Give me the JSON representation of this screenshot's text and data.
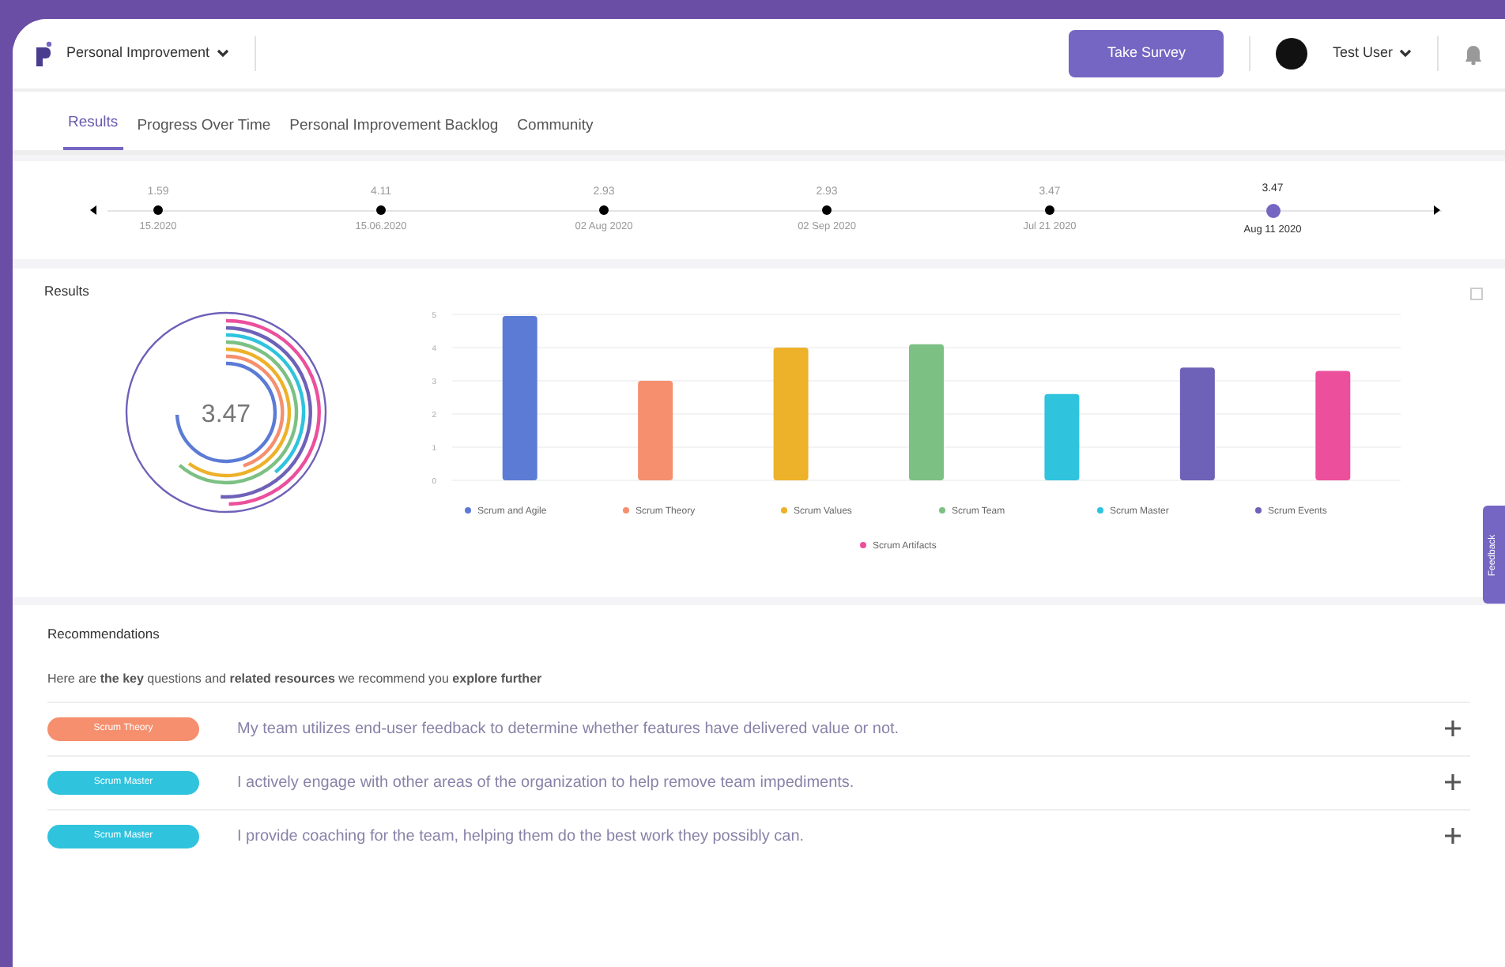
{
  "header": {
    "workspace": "Personal Improvement",
    "survey_button": "Take Survey",
    "user": "Test User"
  },
  "tabs": [
    {
      "label": "Results",
      "selected": true
    },
    {
      "label": "Progress Over Time",
      "selected": false
    },
    {
      "label": "Personal Improvement Backlog",
      "selected": false
    },
    {
      "label": "Community",
      "selected": false
    }
  ],
  "timeline": [
    {
      "score": "1.59",
      "date": "15.2020",
      "selected": false
    },
    {
      "score": "4.11",
      "date": "15.06.2020",
      "selected": false
    },
    {
      "score": "2.93",
      "date": "02 Aug 2020",
      "selected": false
    },
    {
      "score": "2.93",
      "date": "02 Sep 2020",
      "selected": false
    },
    {
      "score": "3.47",
      "date": "Jul 21 2020",
      "selected": false
    },
    {
      "score": "3.47",
      "date": "Aug 11 2020",
      "selected": true
    }
  ],
  "results": {
    "title": "Results",
    "overall_score": "3.47",
    "chart_data": {
      "type": "bar",
      "grid": true,
      "legend": "bottom",
      "series": [
        {
          "name": "Scrum and Agile",
          "color": "#5b7bd5",
          "values": [
            4.95
          ]
        },
        {
          "name": "Scrum Theory",
          "color": "#f58f6e",
          "values": [
            3.0
          ]
        },
        {
          "name": "Scrum Values",
          "color": "#edb12a",
          "values": [
            4.0
          ]
        },
        {
          "name": "Scrum Team",
          "color": "#7cc083",
          "values": [
            4.1
          ]
        },
        {
          "name": "Scrum Master",
          "color": "#2fc3de",
          "values": [
            2.6
          ]
        },
        {
          "name": "Scrum Events",
          "color": "#6e61b8",
          "values": [
            3.4
          ]
        },
        {
          "name": "Scrum Artifacts",
          "color": "#ec4f9c",
          "values": [
            3.3
          ]
        }
      ],
      "ylim": [
        0,
        5
      ],
      "yticks": [
        0,
        1,
        2,
        3,
        4,
        5
      ]
    }
  },
  "recommendations": {
    "title": "Recommendations",
    "intro": "Here are **the key** questions and **related resources** we recommend you **explore further**",
    "items": [
      {
        "tag": "Scrum Theory",
        "color": "#f58f6e",
        "text": "My team utilizes end-user feedback to determine whether features have delivered value or not."
      },
      {
        "tag": "Scrum Master",
        "color": "#2fc3de",
        "text": "I actively engage with other areas of the organization to help remove team impediments."
      },
      {
        "tag": "Scrum Master",
        "color": "#2fc3de",
        "text": "I provide coaching for the team, helping them do the best work they possibly can."
      }
    ]
  },
  "feedback_tab": "Feedback"
}
